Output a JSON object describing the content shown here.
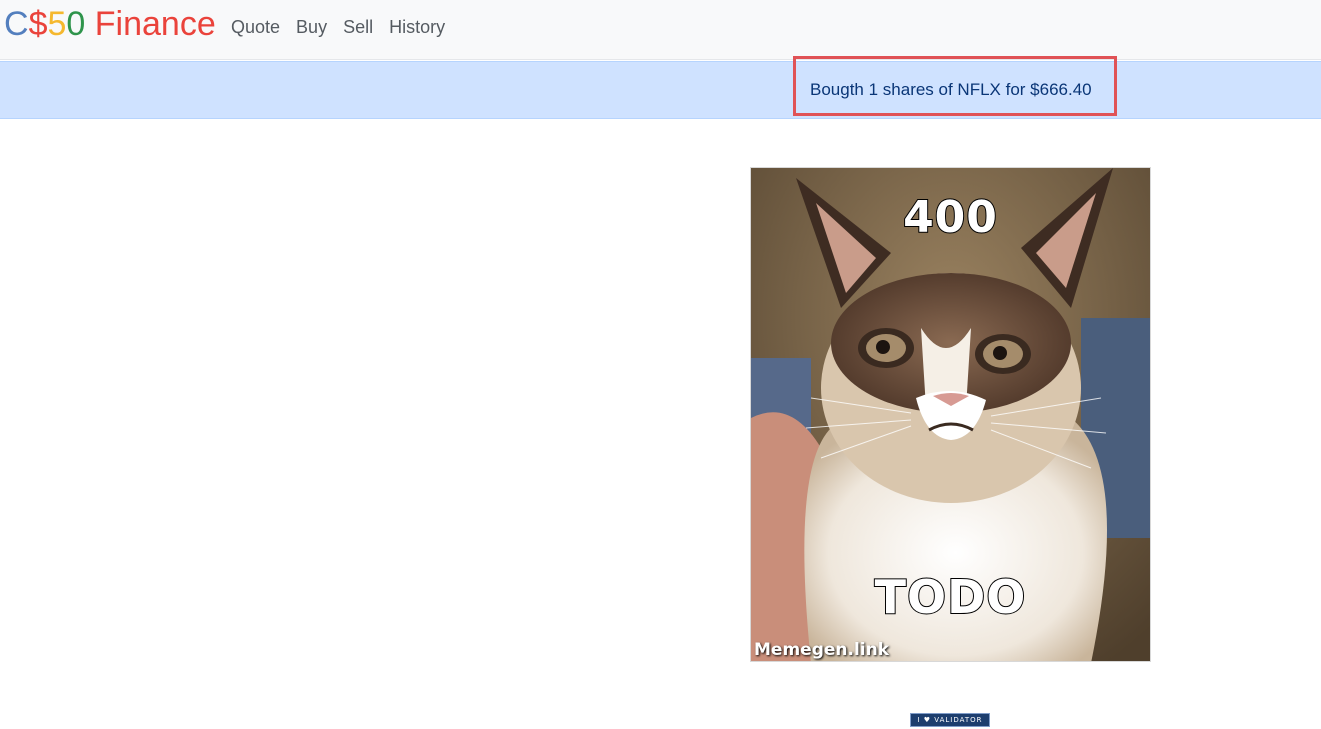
{
  "navbar": {
    "brand": {
      "c": "C",
      "dollar": "$",
      "five": "5",
      "zero": "0",
      "finance": " Finance",
      "colors": {
        "c": "#537fbe",
        "dollar": "#ea433b",
        "five": "#f5b82e",
        "zero": "#2e944b",
        "finance": "#ea433b"
      }
    },
    "links": [
      "Quote",
      "Buy",
      "Sell",
      "History"
    ]
  },
  "alert": {
    "message": "Bougth 1 shares of NFLX for $666.40"
  },
  "meme": {
    "top_text": "400",
    "bottom_text": "TODO",
    "watermark": "Memegen.link",
    "subject": "grumpy cat"
  },
  "footer": {
    "validator_badge": "I ♥ VALIDATOR"
  }
}
